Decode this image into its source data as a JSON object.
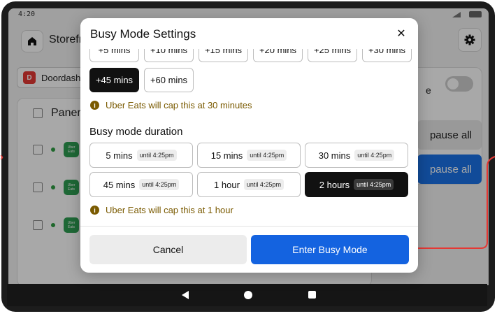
{
  "status": {
    "time": "4:20"
  },
  "background": {
    "title": "Storefr",
    "channel_chip": "Doordash",
    "panel_header": "Paner",
    "dd_logo_letter": "D",
    "ue_logo_text": "Uber Eats",
    "right_label": "e",
    "pause_all": "pause all",
    "unpause_all": "pause all"
  },
  "modal": {
    "title": "Busy Mode Settings",
    "close_glyph": "✕",
    "delay_options": [
      "+5 mins",
      "+10 mins",
      "+15 mins",
      "+20 mins",
      "+25 mins",
      "+30 mins"
    ],
    "delay_options_row2": [
      "+45 mins",
      "+60 mins"
    ],
    "selected_delay": "+45 mins",
    "delay_note": "Uber Eats will cap this at 30 minutes",
    "duration_label": "Busy mode duration",
    "durations": [
      {
        "label": "5 mins",
        "until": "until 4:25pm"
      },
      {
        "label": "15 mins",
        "until": "until 4:25pm"
      },
      {
        "label": "30 mins",
        "until": "until 4:25pm"
      },
      {
        "label": "45 mins",
        "until": "until 4:25pm"
      },
      {
        "label": "1 hour",
        "until": "until 4:25pm"
      },
      {
        "label": "2 hours",
        "until": "until 4:25pm"
      }
    ],
    "selected_duration": "2 hours",
    "duration_note": "Uber Eats will cap this at 1 hour",
    "cancel_label": "Cancel",
    "enter_label": "Enter Busy Mode"
  },
  "colors": {
    "accent": "#1463e0",
    "warning": "#7a5a00",
    "annotation": "#e53935"
  },
  "icons": {
    "home": "home-icon",
    "gear": "gear-icon",
    "info": "info-icon",
    "close": "close-icon"
  }
}
